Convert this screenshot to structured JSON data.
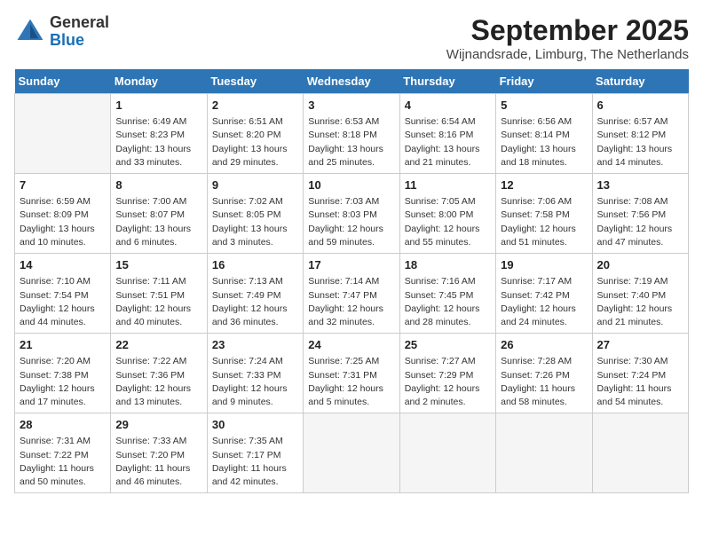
{
  "logo": {
    "line1": "General",
    "line2": "Blue"
  },
  "title": "September 2025",
  "location": "Wijnandsrade, Limburg, The Netherlands",
  "weekdays": [
    "Sunday",
    "Monday",
    "Tuesday",
    "Wednesday",
    "Thursday",
    "Friday",
    "Saturday"
  ],
  "weeks": [
    [
      {
        "day": "",
        "info": ""
      },
      {
        "day": "1",
        "info": "Sunrise: 6:49 AM\nSunset: 8:23 PM\nDaylight: 13 hours\nand 33 minutes."
      },
      {
        "day": "2",
        "info": "Sunrise: 6:51 AM\nSunset: 8:20 PM\nDaylight: 13 hours\nand 29 minutes."
      },
      {
        "day": "3",
        "info": "Sunrise: 6:53 AM\nSunset: 8:18 PM\nDaylight: 13 hours\nand 25 minutes."
      },
      {
        "day": "4",
        "info": "Sunrise: 6:54 AM\nSunset: 8:16 PM\nDaylight: 13 hours\nand 21 minutes."
      },
      {
        "day": "5",
        "info": "Sunrise: 6:56 AM\nSunset: 8:14 PM\nDaylight: 13 hours\nand 18 minutes."
      },
      {
        "day": "6",
        "info": "Sunrise: 6:57 AM\nSunset: 8:12 PM\nDaylight: 13 hours\nand 14 minutes."
      }
    ],
    [
      {
        "day": "7",
        "info": "Sunrise: 6:59 AM\nSunset: 8:09 PM\nDaylight: 13 hours\nand 10 minutes."
      },
      {
        "day": "8",
        "info": "Sunrise: 7:00 AM\nSunset: 8:07 PM\nDaylight: 13 hours\nand 6 minutes."
      },
      {
        "day": "9",
        "info": "Sunrise: 7:02 AM\nSunset: 8:05 PM\nDaylight: 13 hours\nand 3 minutes."
      },
      {
        "day": "10",
        "info": "Sunrise: 7:03 AM\nSunset: 8:03 PM\nDaylight: 12 hours\nand 59 minutes."
      },
      {
        "day": "11",
        "info": "Sunrise: 7:05 AM\nSunset: 8:00 PM\nDaylight: 12 hours\nand 55 minutes."
      },
      {
        "day": "12",
        "info": "Sunrise: 7:06 AM\nSunset: 7:58 PM\nDaylight: 12 hours\nand 51 minutes."
      },
      {
        "day": "13",
        "info": "Sunrise: 7:08 AM\nSunset: 7:56 PM\nDaylight: 12 hours\nand 47 minutes."
      }
    ],
    [
      {
        "day": "14",
        "info": "Sunrise: 7:10 AM\nSunset: 7:54 PM\nDaylight: 12 hours\nand 44 minutes."
      },
      {
        "day": "15",
        "info": "Sunrise: 7:11 AM\nSunset: 7:51 PM\nDaylight: 12 hours\nand 40 minutes."
      },
      {
        "day": "16",
        "info": "Sunrise: 7:13 AM\nSunset: 7:49 PM\nDaylight: 12 hours\nand 36 minutes."
      },
      {
        "day": "17",
        "info": "Sunrise: 7:14 AM\nSunset: 7:47 PM\nDaylight: 12 hours\nand 32 minutes."
      },
      {
        "day": "18",
        "info": "Sunrise: 7:16 AM\nSunset: 7:45 PM\nDaylight: 12 hours\nand 28 minutes."
      },
      {
        "day": "19",
        "info": "Sunrise: 7:17 AM\nSunset: 7:42 PM\nDaylight: 12 hours\nand 24 minutes."
      },
      {
        "day": "20",
        "info": "Sunrise: 7:19 AM\nSunset: 7:40 PM\nDaylight: 12 hours\nand 21 minutes."
      }
    ],
    [
      {
        "day": "21",
        "info": "Sunrise: 7:20 AM\nSunset: 7:38 PM\nDaylight: 12 hours\nand 17 minutes."
      },
      {
        "day": "22",
        "info": "Sunrise: 7:22 AM\nSunset: 7:36 PM\nDaylight: 12 hours\nand 13 minutes."
      },
      {
        "day": "23",
        "info": "Sunrise: 7:24 AM\nSunset: 7:33 PM\nDaylight: 12 hours\nand 9 minutes."
      },
      {
        "day": "24",
        "info": "Sunrise: 7:25 AM\nSunset: 7:31 PM\nDaylight: 12 hours\nand 5 minutes."
      },
      {
        "day": "25",
        "info": "Sunrise: 7:27 AM\nSunset: 7:29 PM\nDaylight: 12 hours\nand 2 minutes."
      },
      {
        "day": "26",
        "info": "Sunrise: 7:28 AM\nSunset: 7:26 PM\nDaylight: 11 hours\nand 58 minutes."
      },
      {
        "day": "27",
        "info": "Sunrise: 7:30 AM\nSunset: 7:24 PM\nDaylight: 11 hours\nand 54 minutes."
      }
    ],
    [
      {
        "day": "28",
        "info": "Sunrise: 7:31 AM\nSunset: 7:22 PM\nDaylight: 11 hours\nand 50 minutes."
      },
      {
        "day": "29",
        "info": "Sunrise: 7:33 AM\nSunset: 7:20 PM\nDaylight: 11 hours\nand 46 minutes."
      },
      {
        "day": "30",
        "info": "Sunrise: 7:35 AM\nSunset: 7:17 PM\nDaylight: 11 hours\nand 42 minutes."
      },
      {
        "day": "",
        "info": ""
      },
      {
        "day": "",
        "info": ""
      },
      {
        "day": "",
        "info": ""
      },
      {
        "day": "",
        "info": ""
      }
    ]
  ]
}
